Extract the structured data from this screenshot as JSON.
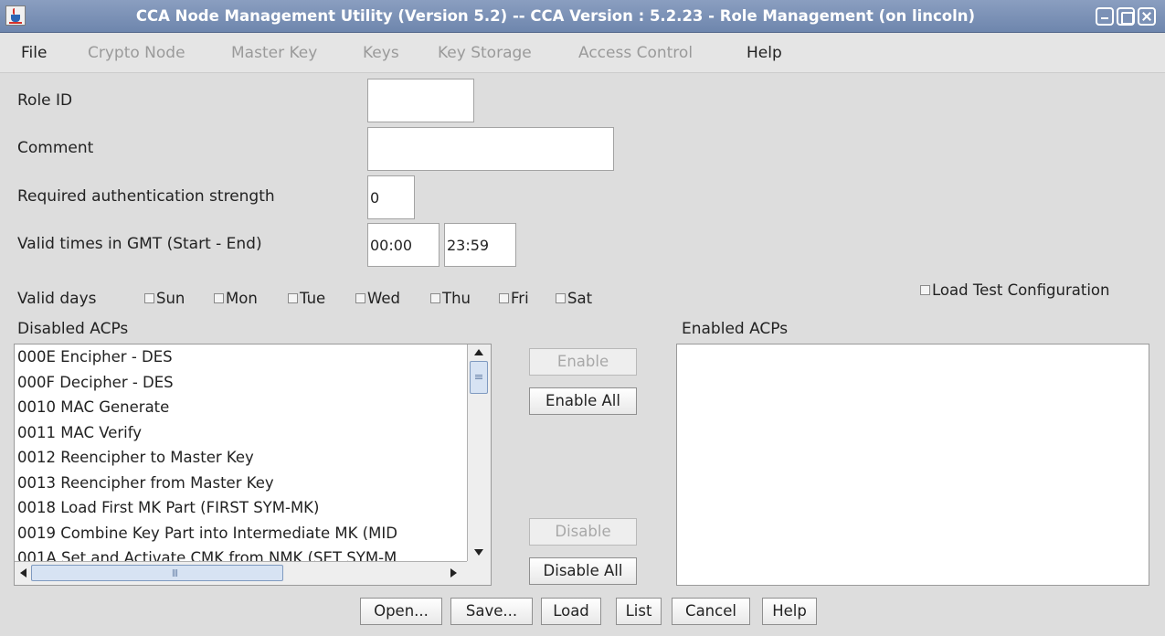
{
  "window": {
    "title": "CCA Node Management Utility (Version 5.2) -- CCA Version : 5.2.23  - Role Management (on lincoln)"
  },
  "menu": [
    {
      "label": "File",
      "enabled": true
    },
    {
      "label": "Crypto Node",
      "enabled": false
    },
    {
      "label": "Master Key",
      "enabled": false
    },
    {
      "label": "Keys",
      "enabled": false
    },
    {
      "label": "Key Storage",
      "enabled": false
    },
    {
      "label": "Access Control",
      "enabled": false
    },
    {
      "label": "Help",
      "enabled": true
    }
  ],
  "form": {
    "role_id": {
      "label": "Role ID",
      "value": ""
    },
    "comment": {
      "label": "Comment",
      "value": ""
    },
    "auth_strength": {
      "label": "Required authentication strength",
      "value": "0"
    },
    "valid_times": {
      "label": "Valid times in GMT (Start - End)",
      "start": "00:00",
      "end": "23:59"
    },
    "valid_days": {
      "label": "Valid days",
      "days": [
        {
          "label": "Sun",
          "checked": false
        },
        {
          "label": "Mon",
          "checked": false
        },
        {
          "label": "Tue",
          "checked": false
        },
        {
          "label": "Wed",
          "checked": false
        },
        {
          "label": "Thu",
          "checked": false
        },
        {
          "label": "Fri",
          "checked": false
        },
        {
          "label": "Sat",
          "checked": false
        }
      ]
    },
    "load_test_config": {
      "label": "Load Test Configuration",
      "checked": false
    }
  },
  "disabled_acps": {
    "label": "Disabled ACPs",
    "items": [
      "000E Encipher - DES",
      "000F Decipher - DES",
      "0010 MAC Generate",
      "0011 MAC Verify",
      "0012 Reencipher to Master Key",
      "0013 Reencipher from Master Key",
      "0018 Load First MK Part (FIRST SYM-MK)",
      "0019 Combine Key Part into Intermediate MK (MID",
      "001A Set and Activate CMK from NMK (SET SYM-M"
    ]
  },
  "enabled_acps": {
    "label": "Enabled ACPs",
    "items": []
  },
  "transfer_buttons": {
    "enable": {
      "label": "Enable",
      "enabled": false
    },
    "enable_all": {
      "label": "Enable All",
      "enabled": true
    },
    "disable": {
      "label": "Disable",
      "enabled": false
    },
    "disable_all": {
      "label": "Disable All",
      "enabled": true
    }
  },
  "bottom_buttons": {
    "open": "Open...",
    "save": "Save...",
    "load": "Load",
    "list": "List",
    "cancel": "Cancel",
    "help": "Help"
  }
}
